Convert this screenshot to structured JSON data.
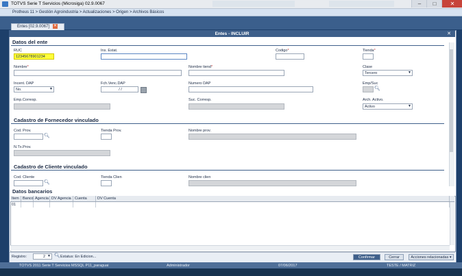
{
  "window": {
    "title": "TOTVS Serie T Servicios (Microsiga) 02.9.0067",
    "minimize": "–",
    "maximize": "□",
    "close": "✕"
  },
  "breadcrumb": "Protheus 11 > Gestión Agroindustria > Actualizaciones > Origen > Archivos Básicos",
  "tab": {
    "label": "Entes [02.9.0067]",
    "close": "✕"
  },
  "dialog": {
    "title": "Entes - INCLUIR",
    "close": "✕",
    "sections": {
      "datos_ente": "Datos del ente",
      "fornecedor": "Cadastro de Fornecedor vinculado",
      "cliente": "Cadastro de Cliente vinculado",
      "bancarios": "Datos bancarios"
    },
    "fields": {
      "ruc": {
        "label": "RUC",
        "value": "12345678901234"
      },
      "ins_estat": {
        "label": "Ins. Estat.",
        "value": ""
      },
      "codigo": {
        "label": "Codigo",
        "req": "*",
        "value": ""
      },
      "tienda": {
        "label": "Tienda",
        "req": "*",
        "value": ""
      },
      "nombre": {
        "label": "Nombre",
        "req": "*",
        "value": ""
      },
      "nombre_tiend": {
        "label": "Nombre tiend",
        "req": "*",
        "value": ""
      },
      "clase": {
        "label": "Clase",
        "value": "Tercero"
      },
      "incent_dap": {
        "label": "Incent. DAP",
        "value": "No."
      },
      "fch_venc_dap": {
        "label": "Fch.Venc.DAP",
        "value": "/ /"
      },
      "numero_dap": {
        "label": "Numero DAP",
        "value": ""
      },
      "emp_suc": {
        "label": "Emp/Suc",
        "value": ""
      },
      "emp_corresp": {
        "label": "Emp.Corresp.",
        "value": ""
      },
      "suc_corresp": {
        "label": "Suc. Corresp.",
        "value": ""
      },
      "arch_activo": {
        "label": "Arch. Activo.",
        "value": "Activo"
      },
      "cod_prov": {
        "label": "Cod. Prov.",
        "value": ""
      },
      "tienda_prov": {
        "label": "Tienda Prov.",
        "value": ""
      },
      "nombre_prov": {
        "label": "Nombre prov.",
        "value": ""
      },
      "n_tx_prov": {
        "label": "N.Tx.Prov.",
        "value": ""
      },
      "cod_cliente": {
        "label": "Cod. Cliente",
        "value": ""
      },
      "tienda_clien": {
        "label": "Tienda Clien",
        "value": ""
      },
      "nombre_clien": {
        "label": "Nombre clien",
        "value": ""
      }
    },
    "grid": {
      "columns": [
        "Item",
        "Banco",
        "Agencia",
        "DV Agencia",
        "Cuenta",
        "DV Cuenta"
      ],
      "rows": [
        [
          "01",
          "",
          "",
          "",
          "",
          ""
        ]
      ]
    },
    "footer": {
      "registro_label": "Registro:",
      "registro_value": "2",
      "estatus": "Estatus: En Edicion...",
      "confirmar": "Confirmar",
      "cerrar": "Cerrar",
      "acciones": "Acciones relacionadas"
    }
  },
  "statusbar": {
    "system": "TOTVS 2011 Serie T Servicios MSSQL P11_paraguai",
    "user": "Administrador",
    "date": "07/06/2017",
    "branch": "TESTE / MATRIZ"
  }
}
